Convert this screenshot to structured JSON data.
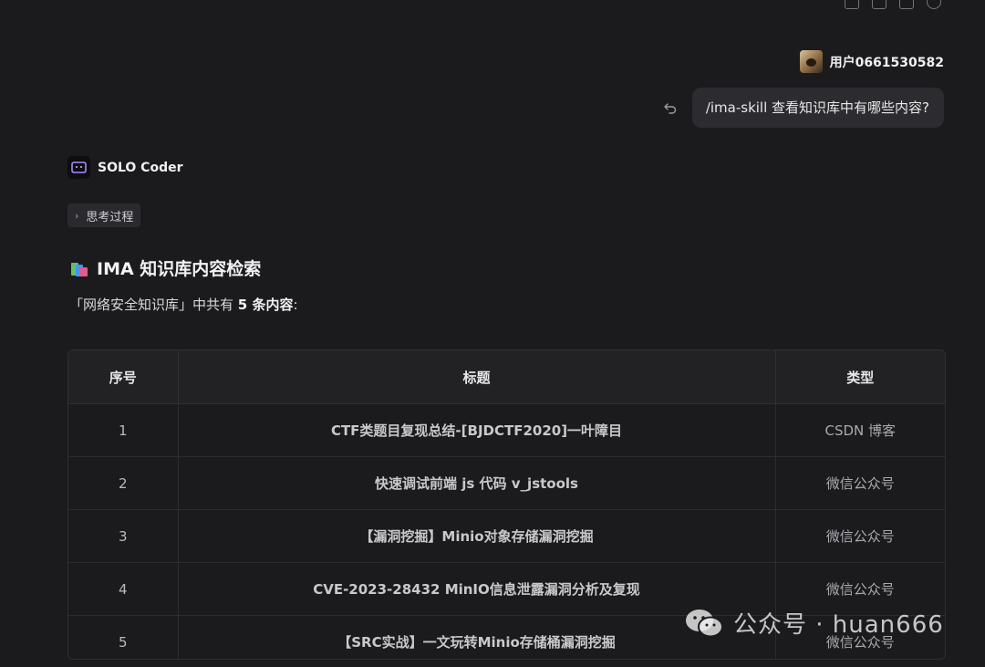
{
  "user": {
    "name": "用户0661530582",
    "message": "/ima-skill 查看知识库中有哪些内容?"
  },
  "assistant": {
    "name": "SOLO Coder",
    "thinking_label": "思考过程",
    "section_title": "IMA 知识库内容检索",
    "summary_prefix": "「网络安全知识库」中共有 ",
    "summary_bold": "5 条内容",
    "summary_suffix": ":"
  },
  "table": {
    "headers": {
      "index": "序号",
      "title": "标题",
      "type": "类型"
    },
    "rows": [
      {
        "index": "1",
        "title": "CTF类题目复现总结-[BJDCTF2020]一叶障目",
        "type": "CSDN 博客"
      },
      {
        "index": "2",
        "title": "快速调试前端 js 代码 v_jstools",
        "type": "微信公众号"
      },
      {
        "index": "3",
        "title": "【漏洞挖掘】Minio对象存储漏洞挖掘",
        "type": "微信公众号"
      },
      {
        "index": "4",
        "title": "CVE-2023-28432 MinIO信息泄露漏洞分析及复现",
        "type": "微信公众号"
      },
      {
        "index": "5",
        "title": "【SRC实战】一文玩转Minio存储桶漏洞挖掘",
        "type": "微信公众号"
      }
    ]
  },
  "watermark": {
    "text": "公众号 · huan666"
  },
  "icons": {
    "top_actions": [
      "copy-icon",
      "thumb-down-icon",
      "duplicate-icon",
      "refresh-icon"
    ],
    "undo": "undo-icon",
    "bot_logo": "solo-coder-logo-icon",
    "section": "books-icon",
    "watermark": "wechat-icon"
  },
  "colors": {
    "background": "#1b1b1e",
    "bubble": "#2c2c30",
    "table_border": "#303034",
    "bot_logo_accent": "#a98cf5"
  }
}
